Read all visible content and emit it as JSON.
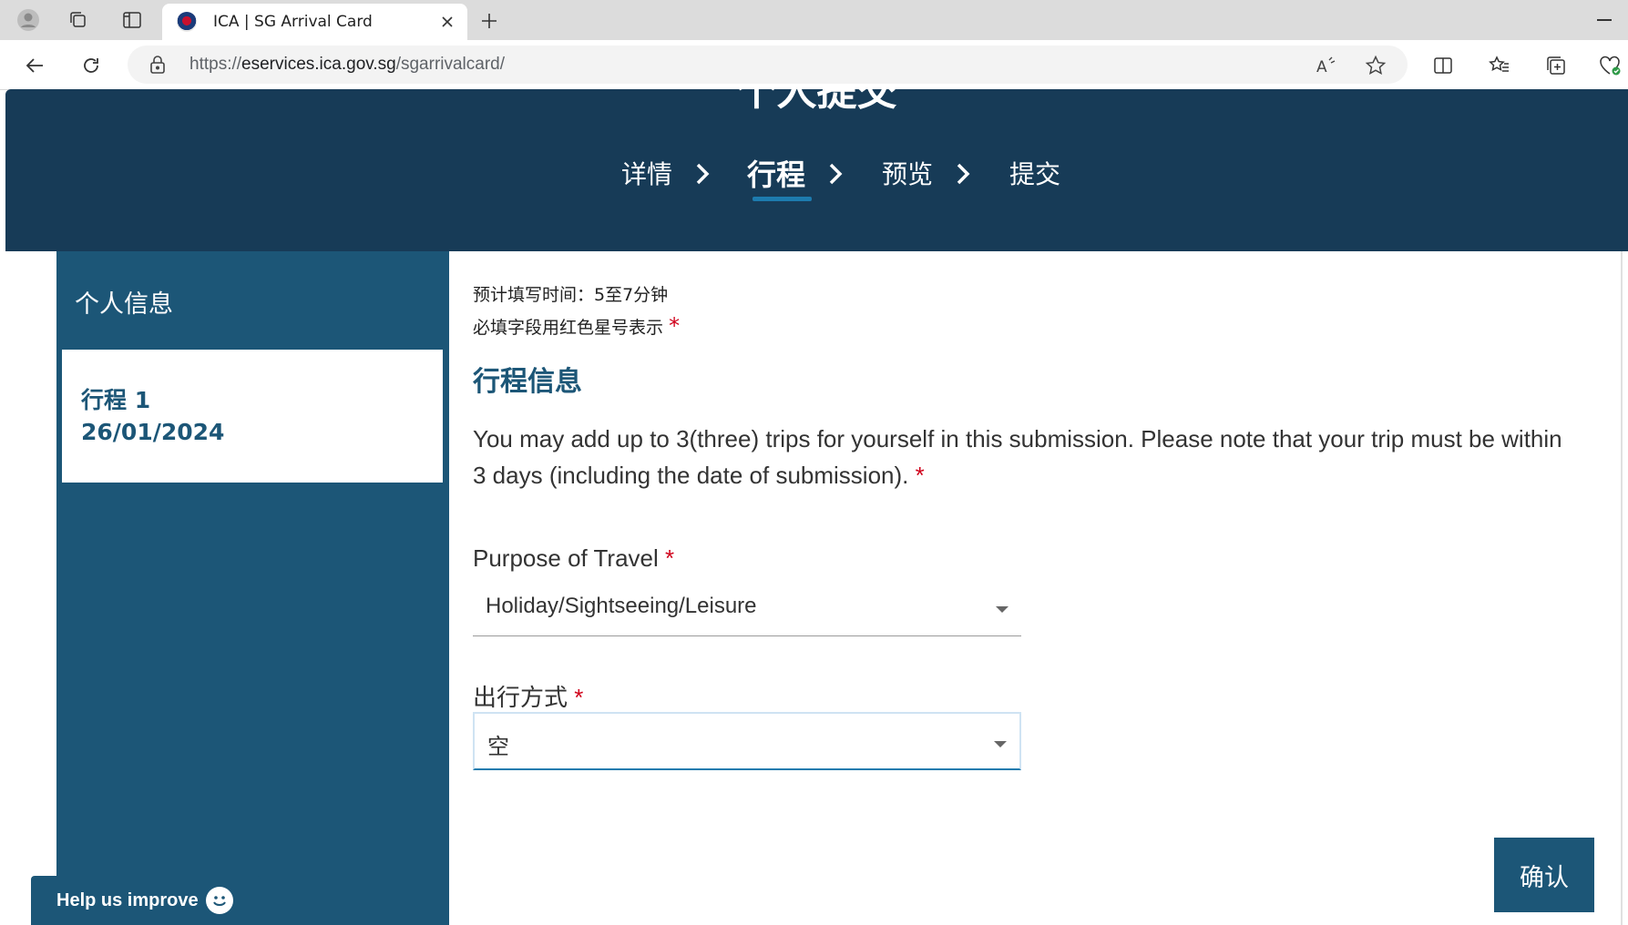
{
  "browser": {
    "tab_title": "ICA | SG Arrival Card",
    "url_prefix": "https://",
    "url_host": "eservices.ica.gov.sg",
    "url_path": "/sgarrivalcard/"
  },
  "header": {
    "page_title": "个人提交",
    "steps": [
      {
        "label": "详情",
        "active": false
      },
      {
        "label": "行程",
        "active": true
      },
      {
        "label": "预览",
        "active": false
      },
      {
        "label": "提交",
        "active": false
      }
    ]
  },
  "sidebar": {
    "heading": "个人信息",
    "trip_card": {
      "title": "行程 1",
      "date": "26/01/2024"
    }
  },
  "form": {
    "est_time": "预计填写时间：5至7分钟",
    "required_note": "必填字段用红色星号表示",
    "required_mark": "*",
    "section_title": "行程信息",
    "notice": "You may add up to 3(three) trips for yourself in this submission. Please note that your trip must be within 3 days (including the date of submission).",
    "purpose_label": "Purpose of Travel",
    "purpose_value": "Holiday/Sightseeing/Leisure",
    "mode_label": "出行方式",
    "mode_value": "空"
  },
  "buttons": {
    "confirm": "确认",
    "help": "Help us improve"
  },
  "colors": {
    "header_bg": "#173b57",
    "sidebar_bg": "#1c5677",
    "accent": "#1d7bae",
    "required": "#d0021b"
  }
}
